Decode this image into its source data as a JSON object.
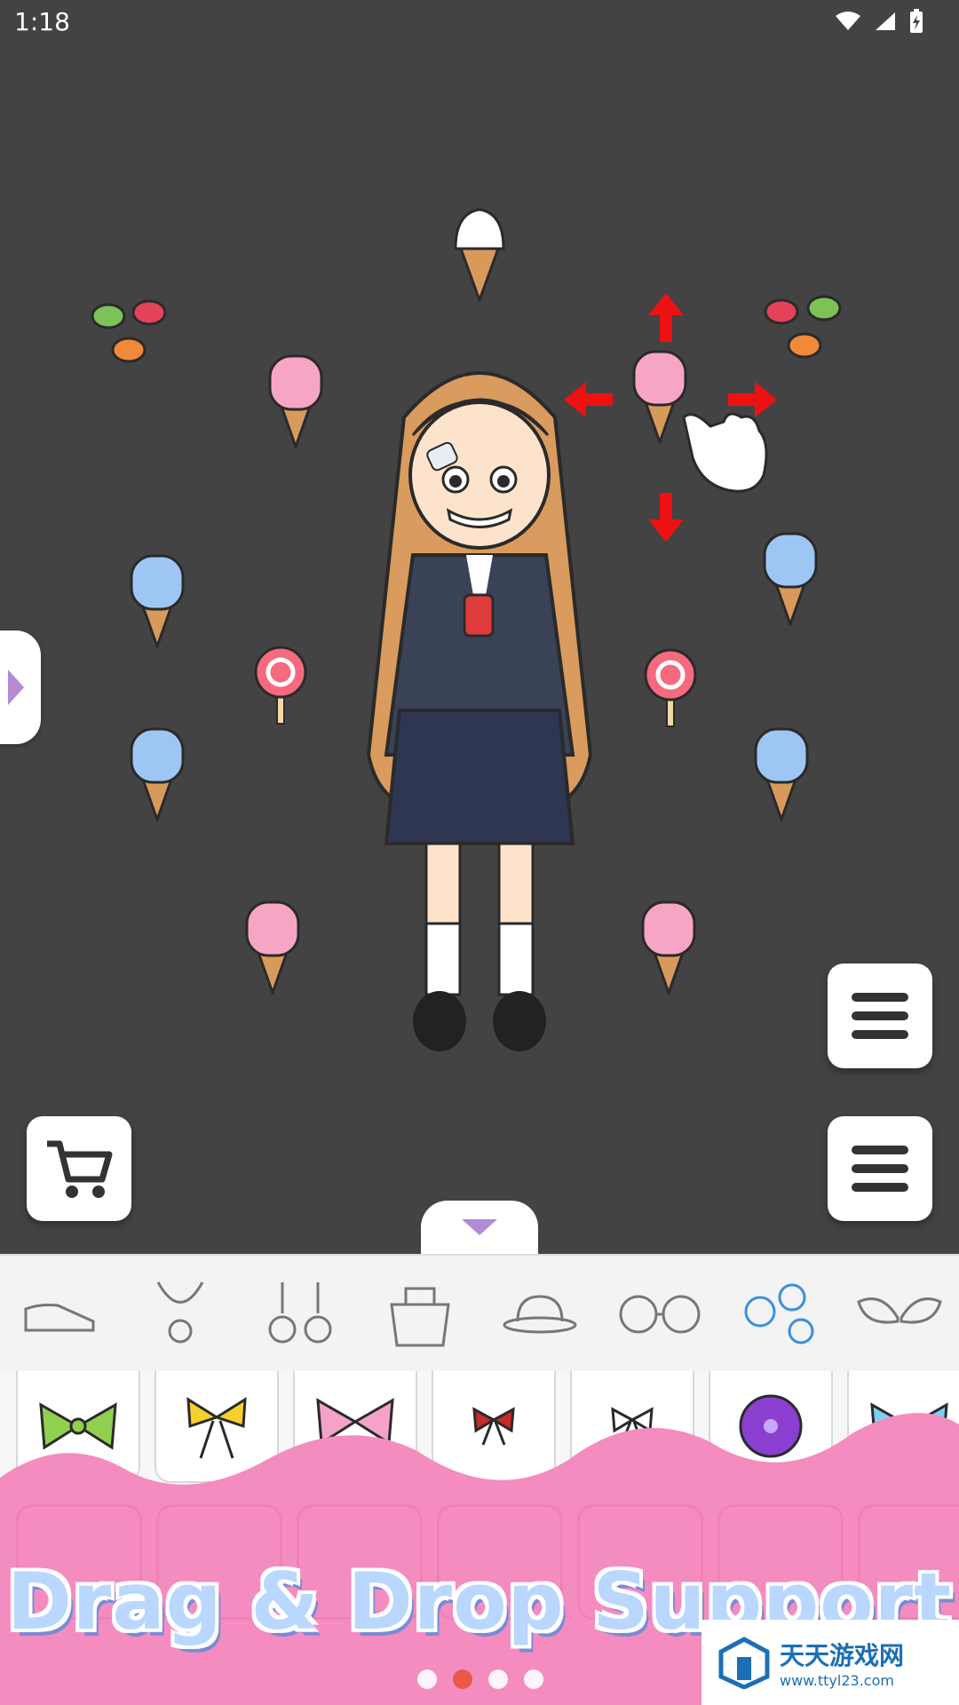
{
  "status_bar": {
    "time": "1:18",
    "battery_icon": "battery-charging-icon"
  },
  "canvas": {
    "background": "#434343",
    "gesture_hint": "drag-hand-icon"
  },
  "buttons": {
    "side_tab_icon": "chevron-right-icon",
    "menu_icon": "hamburger-menu-icon",
    "cart_icon": "shopping-cart-icon",
    "collapse_icon": "chevron-down-icon"
  },
  "categories": [
    {
      "name": "shoes"
    },
    {
      "name": "necklace"
    },
    {
      "name": "earrings"
    },
    {
      "name": "bag"
    },
    {
      "name": "hat"
    },
    {
      "name": "glasses"
    },
    {
      "name": "flowers",
      "selected": true
    },
    {
      "name": "wings"
    }
  ],
  "items": [
    "green bow",
    "yellow bow",
    "pink polka bow",
    "red ribbon",
    "black ribbon",
    "purple flower bow",
    "blue bow"
  ],
  "banner": {
    "text": "Drag & Drop Support",
    "accent": "#f06eab"
  },
  "pagination": {
    "count": 4,
    "active_index": 1
  },
  "watermark": {
    "title": "天天游戏网",
    "url": "www.ttyl23.com"
  }
}
